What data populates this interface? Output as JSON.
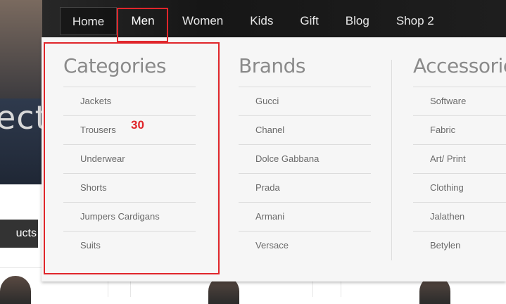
{
  "background": {
    "hero_text": "ect",
    "products_button": "ucts"
  },
  "nav": {
    "items": [
      "Home",
      "Men",
      "Women",
      "Kids",
      "Gift",
      "Blog",
      "Shop 2"
    ]
  },
  "menu": {
    "categories": {
      "title": "Categories",
      "items": [
        "Jackets",
        "Trousers",
        "Underwear",
        "Shorts",
        "Jumpers Cardigans",
        "Suits"
      ]
    },
    "brands": {
      "title": "Brands",
      "items": [
        "Gucci",
        "Chanel",
        "Dolce Gabbana",
        "Prada",
        "Armani",
        "Versace"
      ]
    },
    "accessories": {
      "title": "Accessories",
      "items": [
        "Software",
        "Fabric",
        "Art/ Print",
        "Clothing",
        "Jalathen",
        "Betylen"
      ]
    }
  },
  "annotation": {
    "label": "30",
    "color": "#e0262b"
  }
}
